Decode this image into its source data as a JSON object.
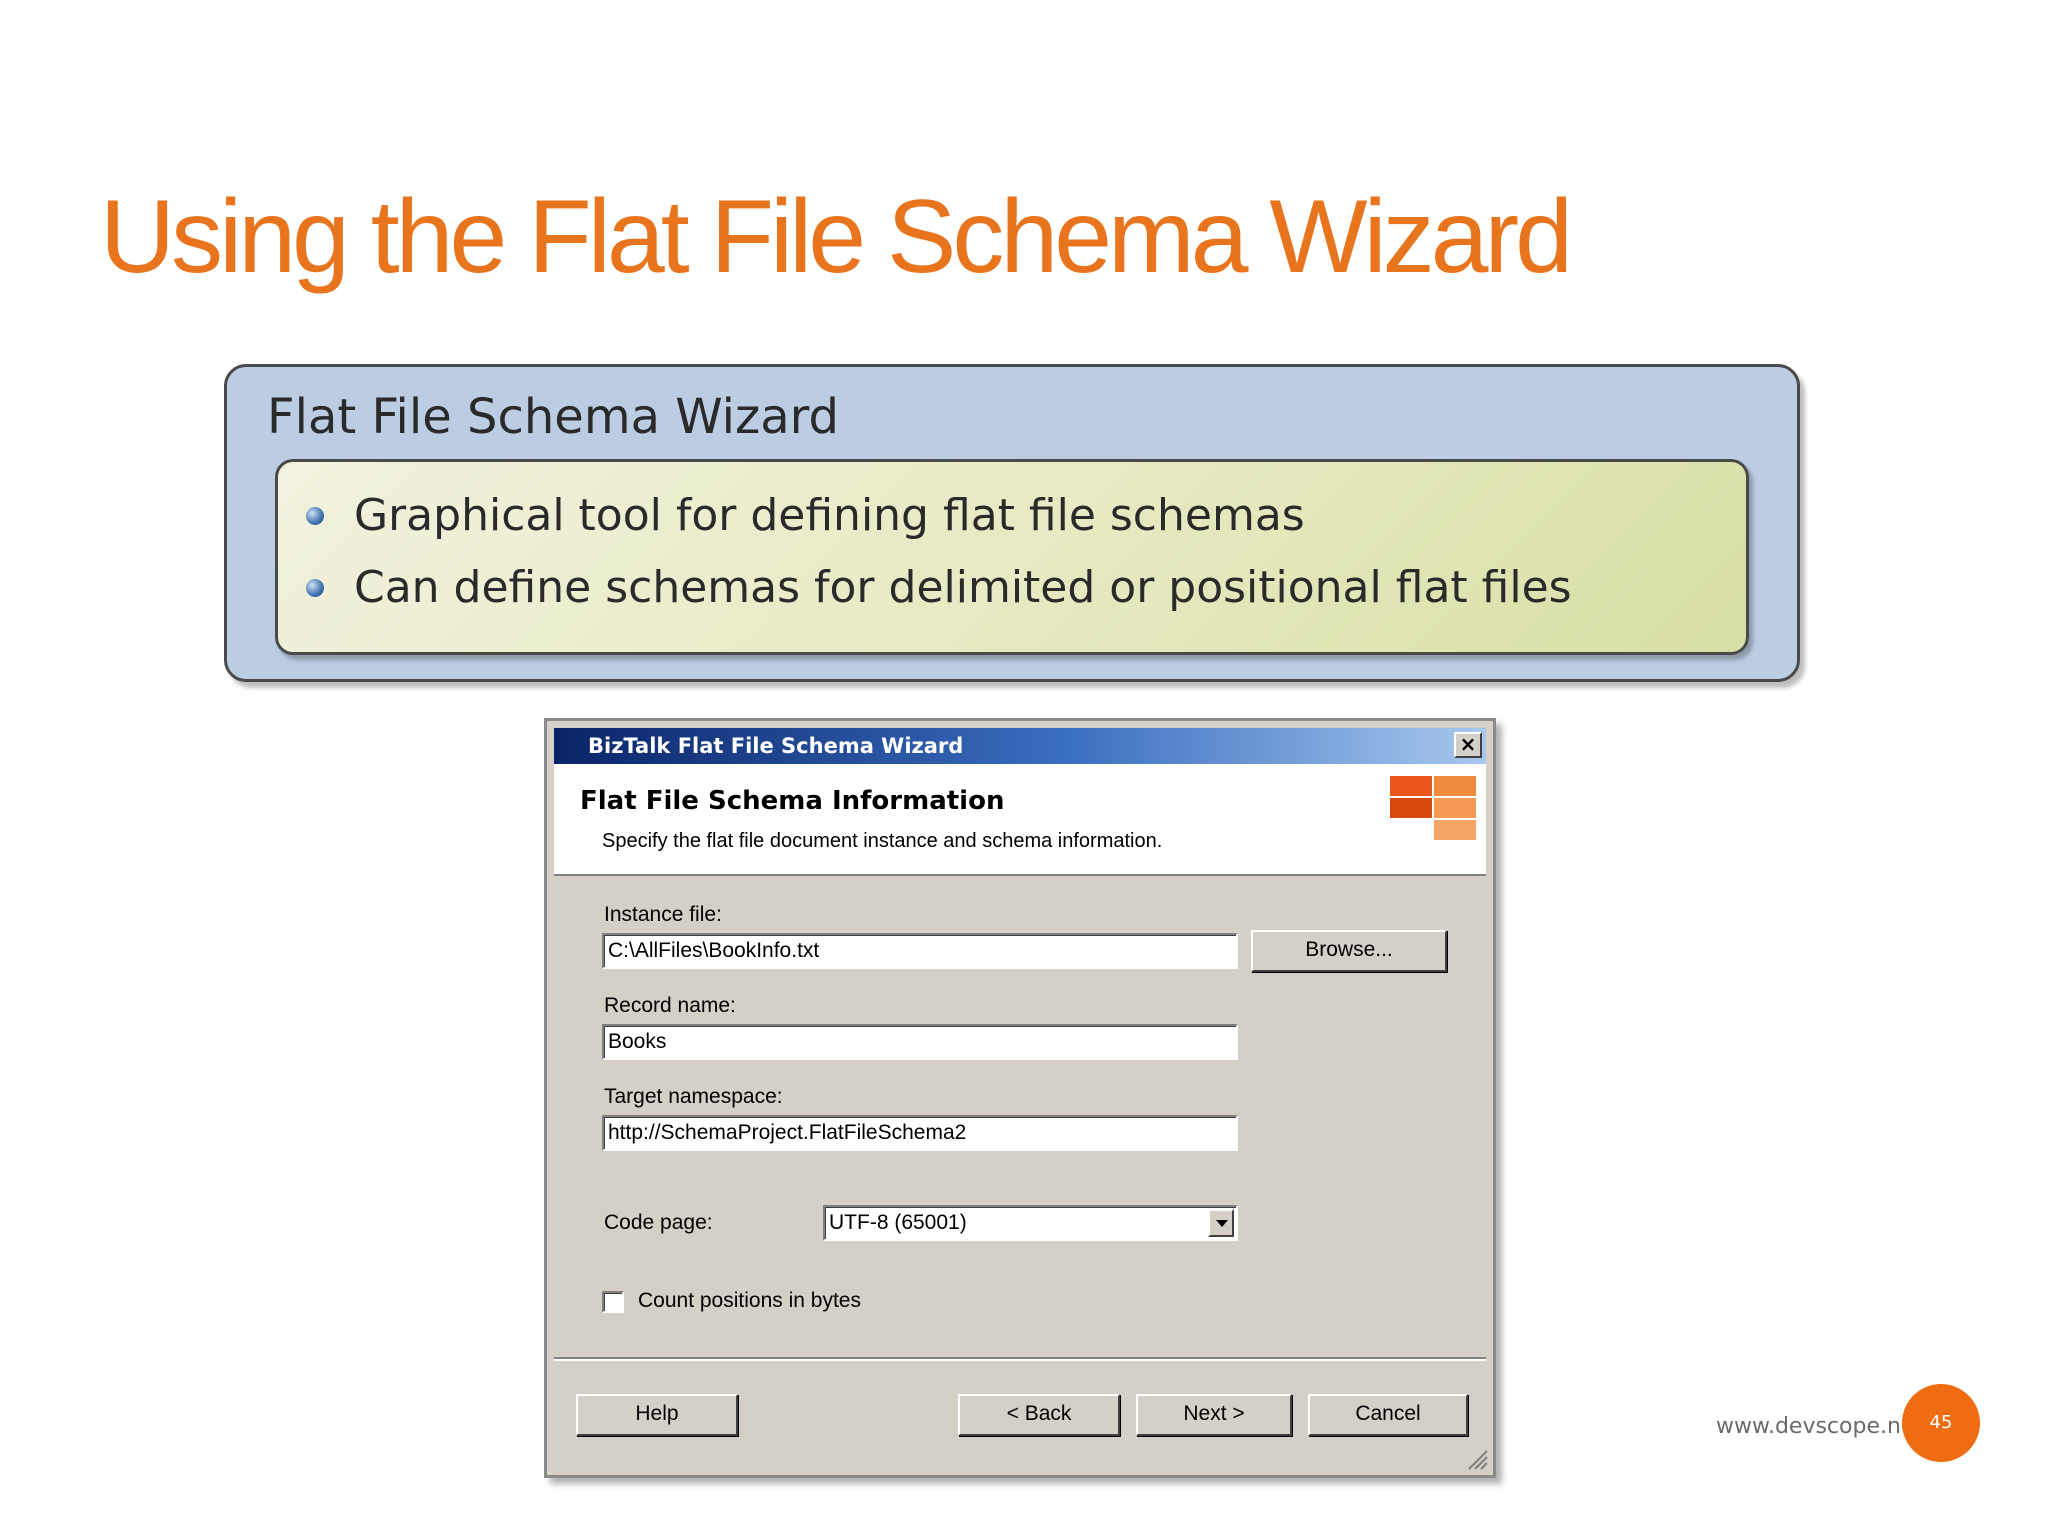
{
  "slide": {
    "title": "Using the Flat File Schema Wizard",
    "box_title": "Flat File Schema Wizard",
    "bullets": [
      "Graphical tool for defining flat file schemas",
      "Can define schemas for delimited or positional flat files"
    ],
    "footer_url": "www.devscope.net",
    "page_number": "45"
  },
  "dialog": {
    "window_title": "BizTalk Flat File Schema Wizard",
    "close_glyph": "×",
    "header_title": "Flat File Schema Information",
    "header_subtitle": "Specify the flat file document instance and schema information.",
    "instance_file_label": "Instance file:",
    "instance_file_value": "C:\\AllFiles\\BookInfo.txt",
    "browse_label": "Browse...",
    "record_name_label": "Record name:",
    "record_name_value": "Books",
    "target_namespace_label": "Target namespace:",
    "target_namespace_value": "http://SchemaProject.FlatFileSchema2",
    "code_page_label": "Code page:",
    "code_page_value": "UTF-8 (65001)",
    "count_positions_label": "Count positions in bytes",
    "count_positions_checked": false,
    "help_label": "Help",
    "back_label": "< Back",
    "next_label": "Next >",
    "cancel_label": "Cancel"
  },
  "colors": {
    "title_orange": "#e8741e",
    "badge_orange": "#ef6c13",
    "outer_box_blue": "#bccde3",
    "inner_box_green": "#e6e9c0",
    "dialog_gray": "#d4d0c8",
    "titlebar_blue": "#0a2468"
  }
}
